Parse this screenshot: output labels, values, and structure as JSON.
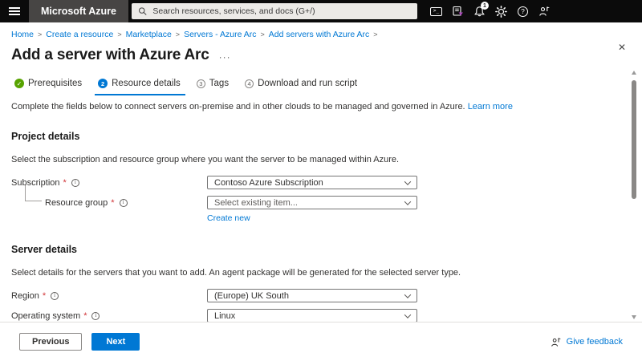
{
  "topbar": {
    "brand": "Microsoft Azure",
    "search_placeholder": "Search resources, services, and docs (G+/)",
    "notification_count": "1"
  },
  "breadcrumb": {
    "separator": ">",
    "items": [
      "Home",
      "Create a resource",
      "Marketplace",
      "Servers - Azure Arc",
      "Add servers with Azure Arc"
    ]
  },
  "page": {
    "title": "Add a server with Azure Arc",
    "intro": "Complete the fields below to connect servers on-premise and in other clouds to be managed and governed in Azure.",
    "learn_more_label": "Learn more"
  },
  "steps": [
    {
      "label": "Prerequisites",
      "state": "complete"
    },
    {
      "number": "2",
      "label": "Resource details",
      "state": "active"
    },
    {
      "number": "3",
      "label": "Tags",
      "state": "upcoming"
    },
    {
      "number": "4",
      "label": "Download and run script",
      "state": "upcoming"
    }
  ],
  "project_details": {
    "heading": "Project details",
    "description": "Select the subscription and resource group where you want the server to be managed within Azure.",
    "subscription": {
      "label": "Subscription",
      "value": "Contoso Azure Subscription"
    },
    "resource_group": {
      "label": "Resource group",
      "placeholder": "Select existing item...",
      "create_new_label": "Create new"
    }
  },
  "server_details": {
    "heading": "Server details",
    "description": "Select details for the servers that you want to add. An agent package will be generated for the selected server type.",
    "region": {
      "label": "Region",
      "value": "(Europe) UK South"
    },
    "operating_system": {
      "label": "Operating system",
      "value": "Linux"
    }
  },
  "footer": {
    "previous_label": "Previous",
    "next_label": "Next",
    "feedback_label": "Give feedback"
  },
  "ui": {
    "required_mark": "*"
  },
  "icons": {
    "check": "✓",
    "close": "✕",
    "more": "···",
    "help": "?",
    "info": "i",
    "cloud_shell": ">_"
  },
  "colors": {
    "accent": "#0078d4",
    "success_green": "#57a300",
    "topbar_bg": "#0b0b0b",
    "brand_bg": "#474544",
    "required_red": "#d13438"
  }
}
